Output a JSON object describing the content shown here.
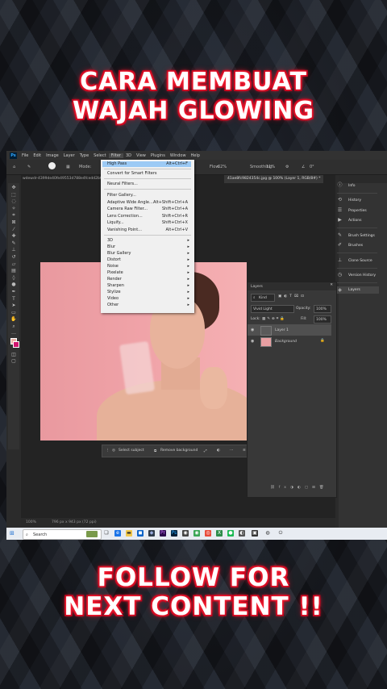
{
  "titles": {
    "line1": "CARA MEMBUAT",
    "line2": "WAJAH GLOWING",
    "line3": "FOLLOW FOR",
    "line4": "NEXT CONTENT !!"
  },
  "app": {
    "logo": "Ps",
    "menus": [
      "File",
      "Edit",
      "Image",
      "Layer",
      "Type",
      "Select",
      "Filter",
      "3D",
      "View",
      "Plugins",
      "Window",
      "Help"
    ],
    "active_menu": "Filter",
    "options": {
      "mode_label": "Mode:",
      "flow_label": "Flow:",
      "flow_value": "62%",
      "smoothing_label": "Smoothing:",
      "smoothing_value": "11%",
      "angle_value": "0°"
    },
    "tab_left": "wdewdr-4399de40fe49553d788e4fcedd2b63a6",
    "tab_right": "41ae8fc9824354c.jpg @ 100% (Layer 1, RGB/8#) *",
    "status_zoom": "100%",
    "status_doc": "796 px x 943 px (72 ppi)"
  },
  "filter_menu": {
    "items": [
      {
        "label": "High Pass",
        "shortcut": "Alt+Ctrl+F",
        "highlight": true
      },
      {
        "label": "Convert for Smart Filters"
      },
      {
        "label": "Neural Filters..."
      },
      {
        "label": "Filter Gallery..."
      },
      {
        "label": "Adaptive Wide Angle...",
        "shortcut": "Alt+Shift+Ctrl+A"
      },
      {
        "label": "Camera Raw Filter...",
        "shortcut": "Shift+Ctrl+A"
      },
      {
        "label": "Lens Correction...",
        "shortcut": "Shift+Ctrl+R"
      },
      {
        "label": "Liquify...",
        "shortcut": "Shift+Ctrl+X"
      },
      {
        "label": "Vanishing Point...",
        "shortcut": "Alt+Ctrl+V"
      },
      {
        "label": "3D",
        "submenu": true
      },
      {
        "label": "Blur",
        "submenu": true
      },
      {
        "label": "Blur Gallery",
        "submenu": true
      },
      {
        "label": "Distort",
        "submenu": true
      },
      {
        "label": "Noise",
        "submenu": true
      },
      {
        "label": "Pixelate",
        "submenu": true
      },
      {
        "label": "Render",
        "submenu": true
      },
      {
        "label": "Sharpen",
        "submenu": true
      },
      {
        "label": "Stylize",
        "submenu": true
      },
      {
        "label": "Video",
        "submenu": true
      },
      {
        "label": "Other",
        "submenu": true
      }
    ]
  },
  "context_bar": {
    "select_subject": "Select subject",
    "remove_background": "Remove background"
  },
  "right_panel": [
    "Info",
    "History",
    "Properties",
    "Actions",
    "Brush Settings",
    "Brushes",
    "Clone Source",
    "Version History",
    "Layers"
  ],
  "layers_panel": {
    "title": "Layers",
    "kind": "Kind",
    "blend_mode": "Vivid Light",
    "opacity_label": "Opacity:",
    "opacity_value": "100%",
    "lock_label": "Lock:",
    "fill_label": "Fill:",
    "fill_value": "100%",
    "layers": [
      {
        "name": "Layer 1",
        "selected": true
      },
      {
        "name": "Background",
        "selected": false
      }
    ]
  },
  "taskbar": {
    "search": "Search"
  },
  "colors": {
    "accent_red": "#ff2a3a",
    "highlight": "#9ccaf5",
    "ps_blue": "#31a8ff"
  }
}
